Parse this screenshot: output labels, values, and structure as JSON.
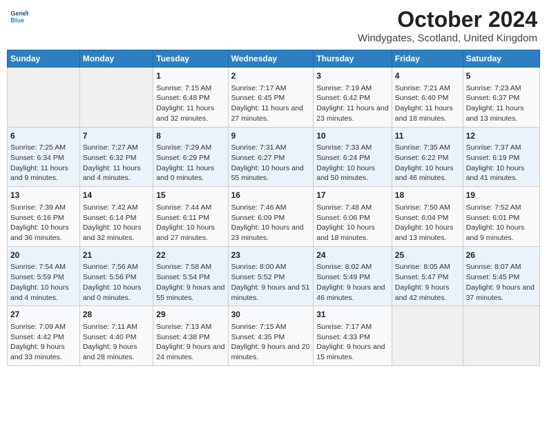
{
  "header": {
    "logo_line1": "General",
    "logo_line2": "Blue",
    "title": "October 2024",
    "subtitle": "Windygates, Scotland, United Kingdom"
  },
  "days_of_week": [
    "Sunday",
    "Monday",
    "Tuesday",
    "Wednesday",
    "Thursday",
    "Friday",
    "Saturday"
  ],
  "weeks": [
    {
      "cells": [
        {
          "day": null,
          "content": null
        },
        {
          "day": null,
          "content": null
        },
        {
          "day": "1",
          "content": "Sunrise: 7:15 AM\nSunset: 6:48 PM\nDaylight: 11 hours and 32 minutes."
        },
        {
          "day": "2",
          "content": "Sunrise: 7:17 AM\nSunset: 6:45 PM\nDaylight: 11 hours and 27 minutes."
        },
        {
          "day": "3",
          "content": "Sunrise: 7:19 AM\nSunset: 6:42 PM\nDaylight: 11 hours and 23 minutes."
        },
        {
          "day": "4",
          "content": "Sunrise: 7:21 AM\nSunset: 6:40 PM\nDaylight: 11 hours and 18 minutes."
        },
        {
          "day": "5",
          "content": "Sunrise: 7:23 AM\nSunset: 6:37 PM\nDaylight: 11 hours and 13 minutes."
        }
      ]
    },
    {
      "cells": [
        {
          "day": "6",
          "content": "Sunrise: 7:25 AM\nSunset: 6:34 PM\nDaylight: 11 hours and 9 minutes."
        },
        {
          "day": "7",
          "content": "Sunrise: 7:27 AM\nSunset: 6:32 PM\nDaylight: 11 hours and 4 minutes."
        },
        {
          "day": "8",
          "content": "Sunrise: 7:29 AM\nSunset: 6:29 PM\nDaylight: 11 hours and 0 minutes."
        },
        {
          "day": "9",
          "content": "Sunrise: 7:31 AM\nSunset: 6:27 PM\nDaylight: 10 hours and 55 minutes."
        },
        {
          "day": "10",
          "content": "Sunrise: 7:33 AM\nSunset: 6:24 PM\nDaylight: 10 hours and 50 minutes."
        },
        {
          "day": "11",
          "content": "Sunrise: 7:35 AM\nSunset: 6:22 PM\nDaylight: 10 hours and 46 minutes."
        },
        {
          "day": "12",
          "content": "Sunrise: 7:37 AM\nSunset: 6:19 PM\nDaylight: 10 hours and 41 minutes."
        }
      ]
    },
    {
      "cells": [
        {
          "day": "13",
          "content": "Sunrise: 7:39 AM\nSunset: 6:16 PM\nDaylight: 10 hours and 36 minutes."
        },
        {
          "day": "14",
          "content": "Sunrise: 7:42 AM\nSunset: 6:14 PM\nDaylight: 10 hours and 32 minutes."
        },
        {
          "day": "15",
          "content": "Sunrise: 7:44 AM\nSunset: 6:11 PM\nDaylight: 10 hours and 27 minutes."
        },
        {
          "day": "16",
          "content": "Sunrise: 7:46 AM\nSunset: 6:09 PM\nDaylight: 10 hours and 23 minutes."
        },
        {
          "day": "17",
          "content": "Sunrise: 7:48 AM\nSunset: 6:06 PM\nDaylight: 10 hours and 18 minutes."
        },
        {
          "day": "18",
          "content": "Sunrise: 7:50 AM\nSunset: 6:04 PM\nDaylight: 10 hours and 13 minutes."
        },
        {
          "day": "19",
          "content": "Sunrise: 7:52 AM\nSunset: 6:01 PM\nDaylight: 10 hours and 9 minutes."
        }
      ]
    },
    {
      "cells": [
        {
          "day": "20",
          "content": "Sunrise: 7:54 AM\nSunset: 5:59 PM\nDaylight: 10 hours and 4 minutes."
        },
        {
          "day": "21",
          "content": "Sunrise: 7:56 AM\nSunset: 5:56 PM\nDaylight: 10 hours and 0 minutes."
        },
        {
          "day": "22",
          "content": "Sunrise: 7:58 AM\nSunset: 5:54 PM\nDaylight: 9 hours and 55 minutes."
        },
        {
          "day": "23",
          "content": "Sunrise: 8:00 AM\nSunset: 5:52 PM\nDaylight: 9 hours and 51 minutes."
        },
        {
          "day": "24",
          "content": "Sunrise: 8:02 AM\nSunset: 5:49 PM\nDaylight: 9 hours and 46 minutes."
        },
        {
          "day": "25",
          "content": "Sunrise: 8:05 AM\nSunset: 5:47 PM\nDaylight: 9 hours and 42 minutes."
        },
        {
          "day": "26",
          "content": "Sunrise: 8:07 AM\nSunset: 5:45 PM\nDaylight: 9 hours and 37 minutes."
        }
      ]
    },
    {
      "cells": [
        {
          "day": "27",
          "content": "Sunrise: 7:09 AM\nSunset: 4:42 PM\nDaylight: 9 hours and 33 minutes."
        },
        {
          "day": "28",
          "content": "Sunrise: 7:11 AM\nSunset: 4:40 PM\nDaylight: 9 hours and 28 minutes."
        },
        {
          "day": "29",
          "content": "Sunrise: 7:13 AM\nSunset: 4:38 PM\nDaylight: 9 hours and 24 minutes."
        },
        {
          "day": "30",
          "content": "Sunrise: 7:15 AM\nSunset: 4:35 PM\nDaylight: 9 hours and 20 minutes."
        },
        {
          "day": "31",
          "content": "Sunrise: 7:17 AM\nSunset: 4:33 PM\nDaylight: 9 hours and 15 minutes."
        },
        {
          "day": null,
          "content": null
        },
        {
          "day": null,
          "content": null
        }
      ]
    }
  ]
}
